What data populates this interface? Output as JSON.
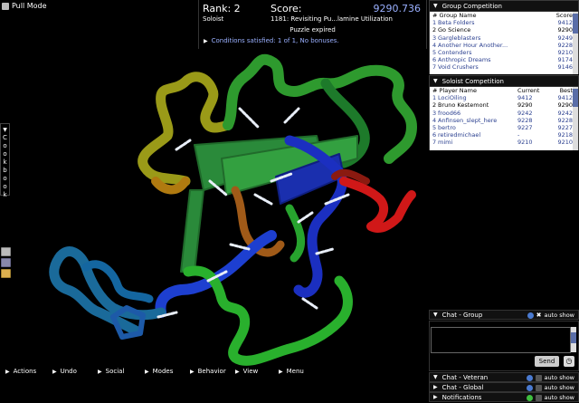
{
  "top_left": {
    "mode_label": "Pull Mode"
  },
  "score_panel": {
    "rank": "Rank: 2",
    "score_label": "Score:",
    "score_value": "9290.736",
    "role": "Soloist",
    "puzzle": "1181: Revisiting Pu...lamine Utilization",
    "status": "Puzzle expired",
    "conditions": "Conditions satisfied: 1 of 1, No bonuses."
  },
  "group_competition": {
    "title": "Group Competition",
    "headers": {
      "name": "# Group Name",
      "score": "Score"
    },
    "rows": [
      {
        "rank": "1",
        "name": "Beta Folders",
        "score": "9412",
        "highlight": false
      },
      {
        "rank": "2",
        "name": "Go Science",
        "score": "9290",
        "highlight": true
      },
      {
        "rank": "3",
        "name": "Gargleblasters",
        "score": "9249",
        "highlight": false
      },
      {
        "rank": "4",
        "name": "Another Hour Another...",
        "score": "9228",
        "highlight": false
      },
      {
        "rank": "5",
        "name": "Contenders",
        "score": "9210",
        "highlight": false
      },
      {
        "rank": "6",
        "name": "Anthropic Dreams",
        "score": "9174",
        "highlight": false
      },
      {
        "rank": "7",
        "name": "Void Crushers",
        "score": "9146",
        "highlight": false
      }
    ]
  },
  "soloist_competition": {
    "title": "Soloist Competition",
    "headers": {
      "name": "# Player Name",
      "current": "Current",
      "best": "Best"
    },
    "rows": [
      {
        "rank": "1",
        "name": "LociOiling",
        "current": "9412",
        "best": "9412",
        "highlight": false
      },
      {
        "rank": "2",
        "name": "Bruno Kestemont",
        "current": "9290",
        "best": "9290",
        "highlight": true
      },
      {
        "rank": "3",
        "name": "frood66",
        "current": "9242",
        "best": "9242",
        "highlight": false
      },
      {
        "rank": "4",
        "name": "Anfinsen_slept_here",
        "current": "9228",
        "best": "9228",
        "highlight": false
      },
      {
        "rank": "5",
        "name": "bertro",
        "current": "9227",
        "best": "9227",
        "highlight": false
      },
      {
        "rank": "6",
        "name": "retiredmichael",
        "current": "-",
        "best": "9218",
        "highlight": false
      },
      {
        "rank": "7",
        "name": "mimi",
        "current": "9210",
        "best": "9210",
        "highlight": false
      }
    ]
  },
  "chat": {
    "group_title": "Chat - Group",
    "auto_show": "auto show",
    "send_label": "Send",
    "veteran_title": "Chat - Veteran",
    "global_title": "Chat - Global",
    "notifications_title": "Notifications"
  },
  "cookbook": {
    "label": "Cookbook",
    "letters": [
      "C",
      "o",
      "o",
      "k",
      "b",
      "o",
      "o",
      "k"
    ]
  },
  "bottom_menu": [
    "Actions",
    "Undo",
    "Social",
    "Modes",
    "Behavior",
    "View",
    "Menu"
  ],
  "colors": {
    "accent": "#9ab0ff",
    "highlight_row": "#000000",
    "normal_row": "#2a3f8f",
    "table_bg": "#ffffff"
  }
}
